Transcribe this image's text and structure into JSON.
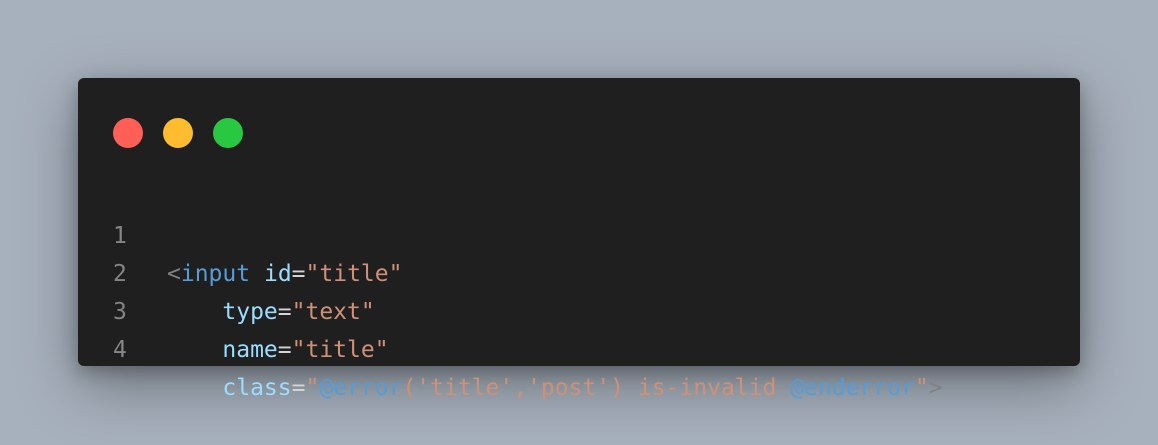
{
  "colors": {
    "background": "#a7b1bd",
    "window": "#1f1f1f",
    "dot_close": "#ff5f57",
    "dot_minimize": "#febc2e",
    "dot_maximize": "#28c840"
  },
  "window_controls": [
    {
      "name": "close",
      "color": "#ff5f57"
    },
    {
      "name": "minimize",
      "color": "#febc2e"
    },
    {
      "name": "maximize",
      "color": "#28c840"
    }
  ],
  "code": {
    "lines": [
      {
        "number": "1",
        "tokens": {
          "open": "<",
          "tag": "input",
          "sp1": " ",
          "attr": "id",
          "eq": "=",
          "value": "\"title\""
        }
      },
      {
        "number": "2",
        "tokens": {
          "indent": "    ",
          "attr": "type",
          "eq": "=",
          "value": "\"text\""
        }
      },
      {
        "number": "3",
        "tokens": {
          "indent": "    ",
          "attr": "name",
          "eq": "=",
          "value": "\"title\""
        }
      },
      {
        "number": "4",
        "tokens": {
          "indent": "    ",
          "attr": "class",
          "eq": "=",
          "q1": "\"",
          "dir1": "@error",
          "mid": "('title','post') is-invalid ",
          "dir2": "@enderror",
          "q2": "\"",
          "close": ">"
        }
      }
    ]
  }
}
